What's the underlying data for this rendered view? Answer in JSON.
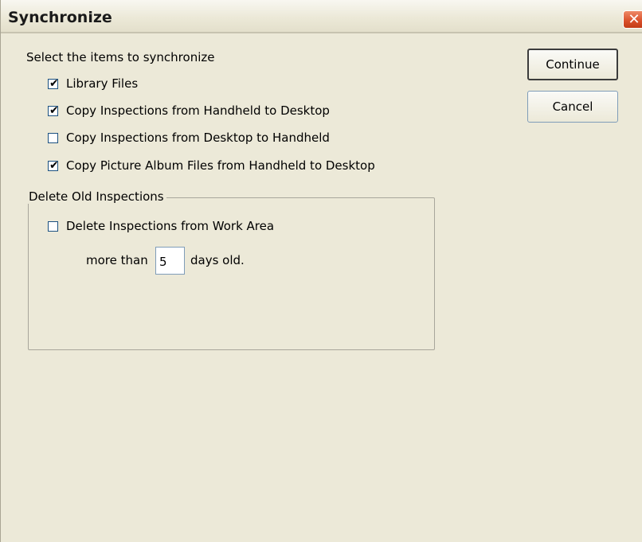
{
  "window": {
    "title": "Synchronize",
    "close_glyph": "✕"
  },
  "sync": {
    "prompt": "Select the items to synchronize",
    "items": [
      {
        "label": "Library Files",
        "checked": true
      },
      {
        "label": "Copy Inspections from Handheld to Desktop",
        "checked": true
      },
      {
        "label": "Copy Inspections from Desktop to Handheld",
        "checked": false
      },
      {
        "label": "Copy Picture Album Files from Handheld to Desktop",
        "checked": true
      }
    ]
  },
  "buttons": {
    "continue": "Continue",
    "cancel": "Cancel"
  },
  "delete_group": {
    "legend": "Delete Old Inspections",
    "checkbox_label": "Delete Inspections from Work Area",
    "checked": false,
    "prefix": "more than",
    "days_value": "5",
    "suffix": "days old."
  },
  "icons": {
    "check": "✔",
    "close": "close-icon"
  },
  "colors": {
    "dialog_background": "#ece9d8",
    "close_button": "#d94e29",
    "input_border": "#7f9db9"
  }
}
